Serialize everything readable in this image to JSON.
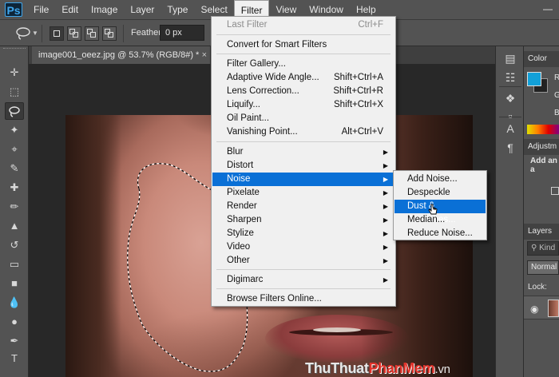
{
  "app": {
    "logo": "Ps",
    "menu": [
      "File",
      "Edit",
      "Image",
      "Layer",
      "Type",
      "Select",
      "Filter",
      "View",
      "Window",
      "Help"
    ],
    "active_menu": "Filter"
  },
  "options_bar": {
    "feather_label": "Feather:",
    "feather_value": "0 px"
  },
  "document": {
    "tab_title": "image001_oeez.jpg @ 53.7% (RGB/8#) *",
    "close_glyph": "×"
  },
  "filter_menu": {
    "items": [
      {
        "label": "Last Filter",
        "shortcut": "Ctrl+F",
        "disabled": true
      },
      {
        "label": "Convert for Smart Filters"
      },
      {
        "label": "Filter Gallery..."
      },
      {
        "label": "Adaptive Wide Angle...",
        "shortcut": "Shift+Ctrl+A"
      },
      {
        "label": "Lens Correction...",
        "shortcut": "Shift+Ctrl+R"
      },
      {
        "label": "Liquify...",
        "shortcut": "Shift+Ctrl+X"
      },
      {
        "label": "Oil Paint..."
      },
      {
        "label": "Vanishing Point...",
        "shortcut": "Alt+Ctrl+V"
      },
      {
        "label": "Blur",
        "submenu": true
      },
      {
        "label": "Distort",
        "submenu": true
      },
      {
        "label": "Noise",
        "submenu": true,
        "highlighted": true
      },
      {
        "label": "Pixelate",
        "submenu": true
      },
      {
        "label": "Render",
        "submenu": true
      },
      {
        "label": "Sharpen",
        "submenu": true
      },
      {
        "label": "Stylize",
        "submenu": true
      },
      {
        "label": "Video",
        "submenu": true
      },
      {
        "label": "Other",
        "submenu": true
      },
      {
        "label": "Digimarc",
        "submenu": true
      },
      {
        "label": "Browse Filters Online..."
      }
    ],
    "arrow_glyph": "▶"
  },
  "noise_submenu": {
    "items": [
      {
        "label": "Add Noise..."
      },
      {
        "label": "Despeckle"
      },
      {
        "label": "Dust & Scratches...",
        "highlighted": true
      },
      {
        "label": "Median..."
      },
      {
        "label": "Reduce Noise..."
      }
    ]
  },
  "panels": {
    "color_tab": "Color",
    "color_channel_r": "R",
    "color_channel_g": "G",
    "color_channel_b": "B",
    "adjustments_tab": "Adjustm",
    "adjustments_hint": "Add an a",
    "layers_tab": "Layers",
    "layers_search": "Kind",
    "blend_mode": "Normal",
    "lock_label": "Lock:"
  },
  "watermark": {
    "part1": "ThuThuat",
    "part2": "PhanMem",
    "part3": ".vn"
  },
  "colors": {
    "menu_highlight": "#0a70d6",
    "foreground_color": "#12a0d8",
    "watermark_red": "#e0322a"
  }
}
